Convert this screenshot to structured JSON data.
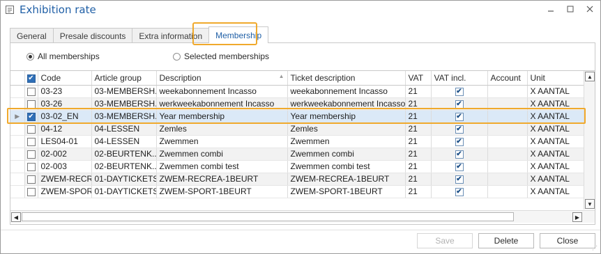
{
  "window": {
    "title": "Exhibition rate"
  },
  "tabs": [
    {
      "label": "General",
      "active": false
    },
    {
      "label": "Presale discounts",
      "active": false
    },
    {
      "label": "Extra information",
      "active": false
    },
    {
      "label": "Membership",
      "active": true
    }
  ],
  "filter": {
    "all_label": "All memberships",
    "selected_label": "Selected memberships",
    "selected": "all"
  },
  "grid": {
    "columns": [
      "Code",
      "Article group",
      "Description",
      "Ticket description",
      "VAT",
      "VAT incl.",
      "Account",
      "Unit"
    ],
    "rows": [
      {
        "checked": false,
        "code": "03-23",
        "group": "03-MEMBERSH...",
        "desc": "weekabonnement Incasso",
        "ticket": "weekabonnement Incasso",
        "vat": "21",
        "vat_incl": true,
        "account": "",
        "unit": "X AANTAL"
      },
      {
        "checked": false,
        "code": "03-26",
        "group": "03-MEMBERSH...",
        "desc": "werkweekabonnement Incasso",
        "ticket": "werkweekabonnement Incasso",
        "vat": "21",
        "vat_incl": true,
        "account": "",
        "unit": "X AANTAL"
      },
      {
        "checked": true,
        "code": "03-02_EN",
        "group": "03-MEMBERSH...",
        "desc": "Year membership",
        "ticket": "Year membership",
        "vat": "21",
        "vat_incl": true,
        "account": "",
        "unit": "X AANTAL",
        "selected": true
      },
      {
        "checked": false,
        "code": "04-12",
        "group": "04-LESSEN",
        "desc": "Zemles",
        "ticket": "Zemles",
        "vat": "21",
        "vat_incl": true,
        "account": "",
        "unit": "X AANTAL"
      },
      {
        "checked": false,
        "code": "LES04-01",
        "group": "04-LESSEN",
        "desc": "Zwemmen",
        "ticket": "Zwemmen",
        "vat": "21",
        "vat_incl": true,
        "account": "",
        "unit": "X AANTAL"
      },
      {
        "checked": false,
        "code": "02-002",
        "group": "02-BEURTENK...",
        "desc": "Zwemmen combi",
        "ticket": "Zwemmen combi",
        "vat": "21",
        "vat_incl": true,
        "account": "",
        "unit": "X AANTAL"
      },
      {
        "checked": false,
        "code": "02-003",
        "group": "02-BEURTENK...",
        "desc": "Zwemmen combi test",
        "ticket": "Zwemmen combi test",
        "vat": "21",
        "vat_incl": true,
        "account": "",
        "unit": "X AANTAL"
      },
      {
        "checked": false,
        "code": "ZWEM-RECREA...",
        "group": "01-DAYTICKETS",
        "desc": "ZWEM-RECREA-1BEURT",
        "ticket": "ZWEM-RECREA-1BEURT",
        "vat": "21",
        "vat_incl": true,
        "account": "",
        "unit": "X AANTAL"
      },
      {
        "checked": false,
        "code": "ZWEM-SPOR...",
        "group": "01-DAYTICKETS",
        "desc": "ZWEM-SPORT-1BEURT",
        "ticket": "ZWEM-SPORT-1BEURT",
        "vat": "21",
        "vat_incl": true,
        "account": "",
        "unit": "X AANTAL"
      }
    ]
  },
  "buttons": {
    "save": "Save",
    "delete": "Delete",
    "close": "Close"
  }
}
